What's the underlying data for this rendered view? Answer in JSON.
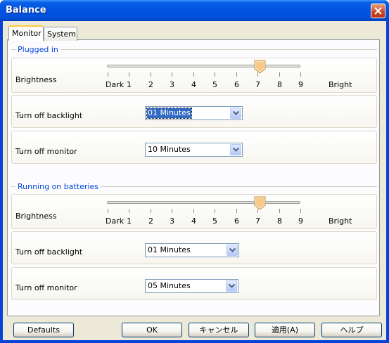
{
  "window": {
    "title": "Balance"
  },
  "tabs": [
    {
      "label": "Monitor"
    },
    {
      "label": "System"
    }
  ],
  "groups": [
    {
      "title": "Plugged in",
      "brightness_label": "Brightness",
      "brightness_level": 7,
      "scale": {
        "min_label": "Dark",
        "ticks": [
          "1",
          "2",
          "3",
          "4",
          "5",
          "6",
          "7",
          "8",
          "9"
        ],
        "max_label": "Bright"
      },
      "backlight_label": "Turn off backlight",
      "backlight_value": "01 Minutes",
      "monitor_label": "Turn off monitor",
      "monitor_value": "10 Minutes"
    },
    {
      "title": "Running on batteries",
      "brightness_label": "Brightness",
      "brightness_level": 7,
      "scale": {
        "min_label": "Dark",
        "ticks": [
          "1",
          "2",
          "3",
          "4",
          "5",
          "6",
          "7",
          "8",
          "9"
        ],
        "max_label": "Bright"
      },
      "backlight_label": "Turn off backlight",
      "backlight_value": "01 Minutes",
      "monitor_label": "Turn off monitor",
      "monitor_value": "05 Minutes"
    }
  ],
  "buttons": {
    "defaults": "Defaults",
    "ok": "OK",
    "cancel": "キャンセル",
    "apply": "適用(A)",
    "help": "ヘルプ"
  }
}
